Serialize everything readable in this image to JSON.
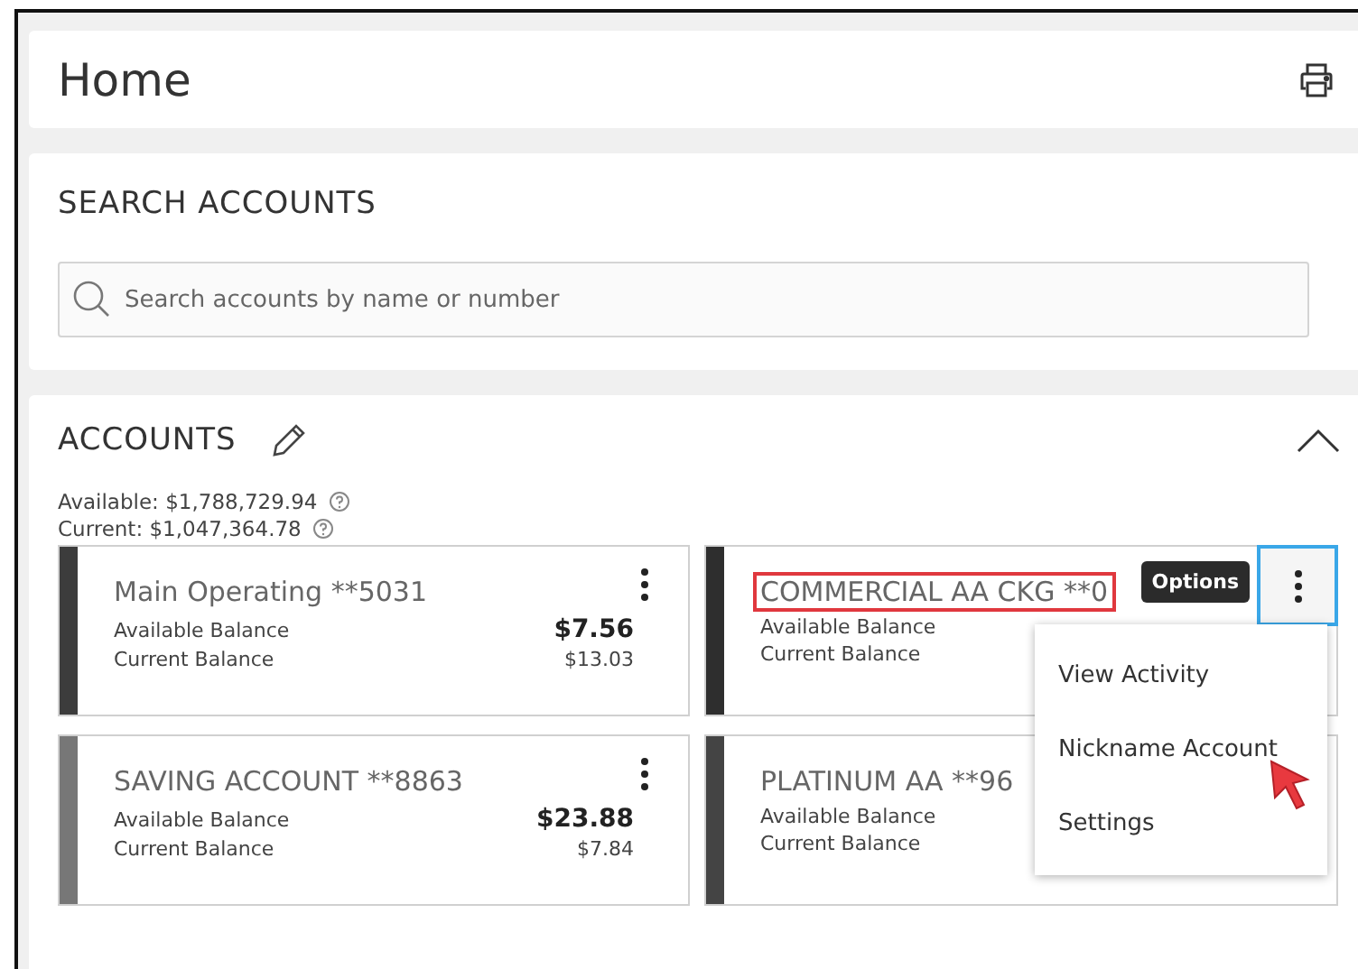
{
  "header": {
    "title": "Home"
  },
  "search": {
    "title": "SEARCH ACCOUNTS",
    "placeholder": "Search accounts by name or number"
  },
  "accounts": {
    "title": "ACCOUNTS",
    "expanded": true,
    "totals": [
      "Available: $1,788,729.94",
      "Current: $1,047,364.78"
    ],
    "cards": [
      {
        "name": "Main Operating **5031",
        "available_label": "Available Balance",
        "available": "$7.56",
        "current_label": "Current Balance",
        "current": "$13.03",
        "color": "#3c3c3c",
        "menu_open": false,
        "highlighted": false
      },
      {
        "name": "COMMERCIAL AA CKG **0",
        "available_label": "Available Balance",
        "current_label": "Current Balance",
        "color": "#2e2e2e",
        "menu_open": true,
        "highlighted": true
      },
      {
        "name": "SAVING ACCOUNT **8863",
        "available_label": "Available Balance",
        "available": "$23.88",
        "current_label": "Current Balance",
        "current": "$7.84",
        "color": "#777777",
        "menu_open": false,
        "highlighted": false
      },
      {
        "name": "PLATINUM AA **96",
        "available_label": "Available Balance",
        "current_label": "Current Balance",
        "color": "#444444",
        "options_button_hidden": true,
        "highlighted": false
      }
    ]
  },
  "options_menu": {
    "tooltip": "Options",
    "items": [
      "View Activity",
      "Nickname Account",
      "Settings"
    ]
  }
}
